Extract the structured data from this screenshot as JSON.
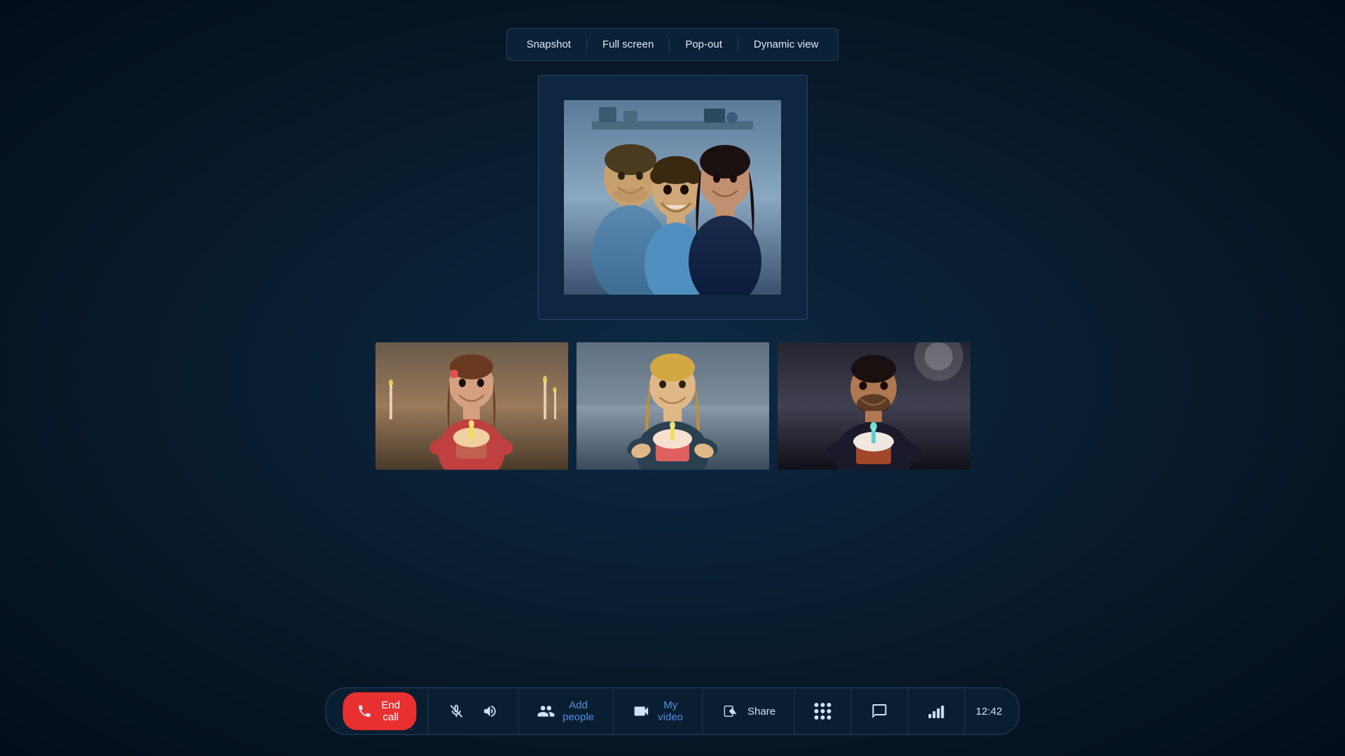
{
  "toolbar": {
    "snapshot_label": "Snapshot",
    "fullscreen_label": "Full screen",
    "popout_label": "Pop-out",
    "dynamic_view_label": "Dynamic view"
  },
  "controls": {
    "end_call_label": "End call",
    "add_people_label": "Add people",
    "my_video_label": "My video",
    "share_label": "Share",
    "time": "12:42"
  },
  "primary_video": {
    "aria_label": "Main video feed - family"
  },
  "secondary_videos": [
    {
      "aria_label": "Video feed - girl with cupcake"
    },
    {
      "aria_label": "Video feed - woman with cupcake"
    },
    {
      "aria_label": "Video feed - man with cupcake"
    }
  ]
}
